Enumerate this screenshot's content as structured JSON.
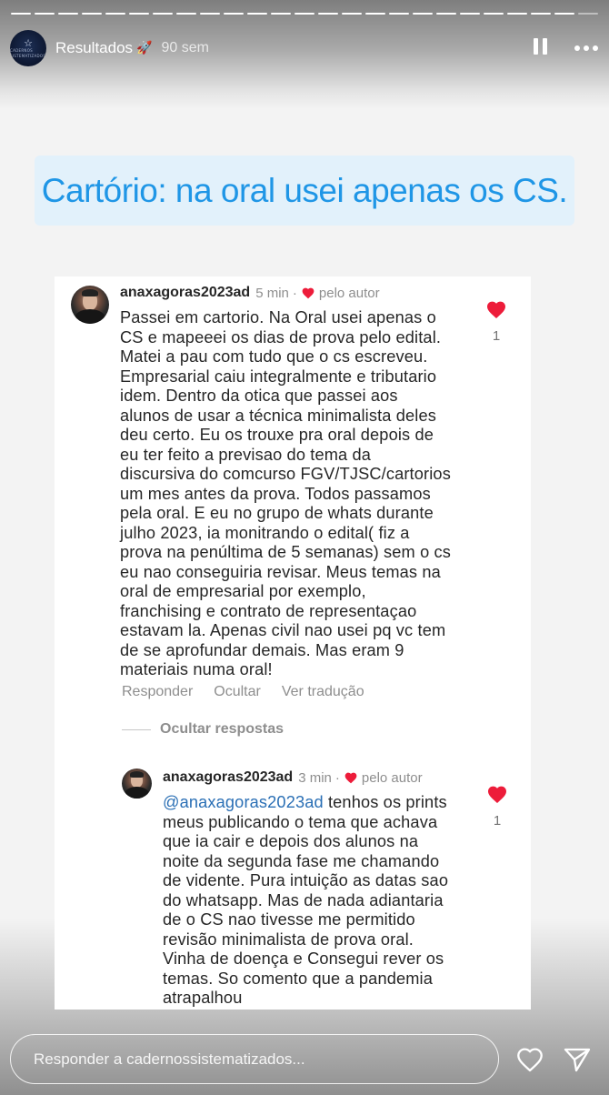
{
  "story": {
    "progress": {
      "segments_total": 25,
      "segments_done": 24
    },
    "header": {
      "avatar_text": "CADERNOS SISTEMATIZADOS",
      "username": "Resultados",
      "badge_emoji": "🚀",
      "time": "90 sem",
      "pause_icon": "pause-icon",
      "more_icon": "more-icon"
    },
    "caption": "Cartório: na oral usei apenas os CS."
  },
  "comment": {
    "user": "anaxagoras2023ad",
    "time": "5 min",
    "dot": "·",
    "author_label": "pelo autor",
    "body": "Passei em cartorio. Na Oral usei apenas o\nCS e mapeeei os dias de prova pelo edital.\nMatei a pau com tudo que o cs escreveu.\nEmpresarial caiu integralmente e tributario\nidem. Dentro da otica que passei aos\nalunos de usar a técnica minimalista deles\ndeu certo. Eu os trouxe pra oral depois de\neu ter feito a previsao do tema da\ndiscursiva do comcurso FGV/TJSC/cartorios\num mes antes da prova. Todos passamos\npela oral. E eu no grupo de whats durante\njulho 2023, ia monitrando o edital( fiz a\nprova na penúltima de 5 semanas) sem o cs\neu nao conseguiria revisar. Meus temas na\noral de empresarial por exemplo,\nfranchising e contrato de representaçao\nestavam la. Apenas civil nao usei pq vc tem\nde se aprofundar demais. Mas eram 9\nmateriais numa oral!",
    "likes": "1",
    "actions": {
      "reply": "Responder",
      "hide": "Ocultar",
      "translate": "Ver tradução"
    },
    "hide_replies": "Ocultar respostas"
  },
  "reply": {
    "user": "anaxagoras2023ad",
    "time": "3 min",
    "dot": "·",
    "author_label": "pelo autor",
    "mention": "@anaxagoras2023ad",
    "body": " tenhos os prints\nmeus publicando o tema que achava\nque ia cair e depois dos alunos na\nnoite da segunda fase me chamando\nde vidente. Pura intuição as datas sao\ndo whatsapp. Mas de nada adiantaria\nde o CS nao tivesse me permitido\nrevisão minimalista de prova oral.\nVinha de doença e Consegui rever os\ntemas. So comento que a pandemia\natrapalhou",
    "likes": "1"
  },
  "footer": {
    "reply_placeholder": "Responder a cadernossistematizados...",
    "like_icon": "heart-outline-icon",
    "send_icon": "send-icon"
  },
  "colors": {
    "caption_text": "#1f96e6",
    "caption_bg": "#e2f1fb",
    "like_red": "#ed1c3a",
    "mention": "#2a6fb5"
  }
}
